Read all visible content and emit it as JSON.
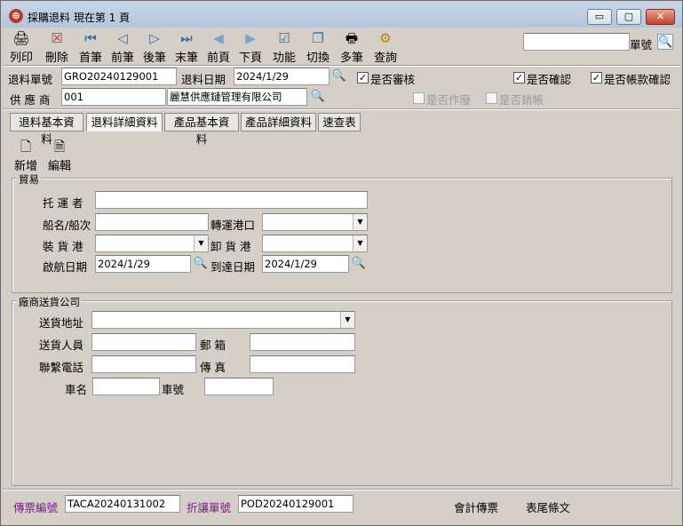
{
  "window": {
    "title": "採購退料  現在第 1 頁",
    "app_icon": "⊕",
    "minimize": "▭",
    "maximize": "▢",
    "close": "✕"
  },
  "toolbar": {
    "print": "列印",
    "delete": "刪除",
    "first": "首筆",
    "prev": "前筆",
    "next": "後筆",
    "last": "末筆",
    "prev_page": "前頁",
    "next_page": "下頁",
    "function": "功能",
    "switch": "切換",
    "multi": "多筆",
    "query": "查詢",
    "doc_no_label": "單號",
    "doc_no_value": ""
  },
  "header": {
    "return_no_label": "退料單號",
    "return_no": "GRO20240129001",
    "return_date_label": "退料日期",
    "return_date": "2024/1/29",
    "approved_label": "是否審核",
    "approved": true,
    "confirmed_label": "是否確認",
    "confirmed": true,
    "account_confirmed_label": "是否帳款確認",
    "account_confirmed": true,
    "supplier_label": "供  應  商",
    "supplier_code": "001",
    "supplier_name": "麗慧供應鏈管理有限公司",
    "void_label": "是否作廢",
    "void": false,
    "closed_label": "是否銷帳",
    "closed": false
  },
  "tabs": [
    "退料基本資料",
    "退料詳細資料",
    "產品基本資料",
    "產品詳細資料",
    "速查表"
  ],
  "active_tab": 1,
  "subtoolbar": {
    "add": "新增",
    "edit": "編輯"
  },
  "trade": {
    "group_title": "貿易",
    "carrier_label": "托  運  者",
    "carrier": "",
    "vessel_label": "船名/船次",
    "vessel": "",
    "transit_port_label": "轉運港口",
    "transit_port": "",
    "loading_port_label": "裝  貨  港",
    "loading_port": "",
    "discharge_port_label": "卸  貨  港",
    "discharge_port": "",
    "departure_label": "啟航日期",
    "departure": "2024/1/29",
    "arrival_label": "到達日期",
    "arrival": "2024/1/29"
  },
  "delivery": {
    "group_title": "廠商送貨公司",
    "address_label": "送貨地址",
    "address": "",
    "person_label": "送貨人員",
    "person": "",
    "postbox_label": "郵        箱",
    "postbox": "",
    "phone_label": "聯繫電話",
    "phone": "",
    "fax_label": "傳        真",
    "fax": "",
    "car_name_label": "車名",
    "car_name": "",
    "car_no_label": "車號",
    "car_no": ""
  },
  "footer": {
    "voucher_label": "傳票編號",
    "voucher": "TACA20240131002",
    "discount_label": "折讓單號",
    "discount": "POD20240129001",
    "accounting_voucher": "會計傳票",
    "footer_terms": "表尾條文"
  }
}
